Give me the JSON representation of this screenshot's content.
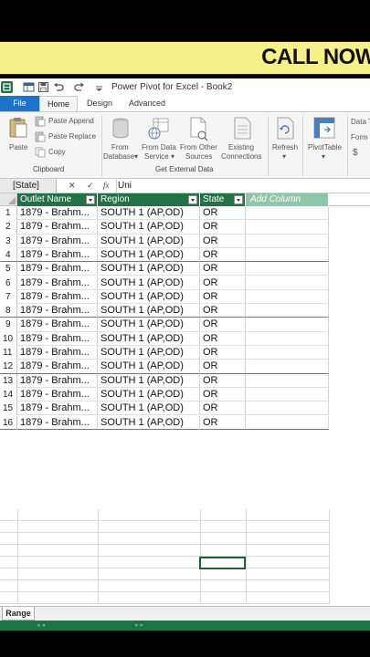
{
  "banner": {
    "text": "CALL NOW"
  },
  "window": {
    "title": "Power Pivot for Excel - Book2"
  },
  "tabs": [
    "File",
    "Home",
    "Design",
    "Advanced"
  ],
  "ribbon": {
    "paste": "Paste",
    "paste_append": "Paste Append",
    "paste_replace": "Paste Replace",
    "copy": "Copy",
    "clipboard_group": "Clipboard",
    "from_database_1": "From",
    "from_database_2": "Database",
    "from_data_service_1": "From Data",
    "from_data_service_2": "Service",
    "from_other_sources_1": "From Other",
    "from_other_sources_2": "Sources",
    "existing_connections_1": "Existing",
    "existing_connections_2": "Connections",
    "get_external_group": "Get External Data",
    "refresh": "Refresh",
    "pivottable": "PivotTable",
    "data_type": "Data T",
    "format": "Form",
    "currency": "$"
  },
  "formula_bar": {
    "name_box": "[State]",
    "cancel": "✕",
    "enter": "✓",
    "fx": "fx",
    "value": "Uni"
  },
  "table": {
    "columns": [
      "Outlet Name",
      "Region",
      "State"
    ],
    "add_column": "Add Column",
    "rows": [
      {
        "num": "1",
        "outlet": "1879 - Brahm...",
        "region": "SOUTH 1 (AP,OD)",
        "state": "OR"
      },
      {
        "num": "2",
        "outlet": "1879 - Brahm...",
        "region": "SOUTH 1 (AP,OD)",
        "state": "OR"
      },
      {
        "num": "3",
        "outlet": "1879 - Brahm...",
        "region": "SOUTH 1 (AP,OD)",
        "state": "OR"
      },
      {
        "num": "4",
        "outlet": "1879 - Brahm...",
        "region": "SOUTH 1 (AP,OD)",
        "state": "OR"
      },
      {
        "num": "5",
        "outlet": "1879 - Brahm...",
        "region": "SOUTH 1 (AP,OD)",
        "state": "OR"
      },
      {
        "num": "6",
        "outlet": "1879 - Brahm...",
        "region": "SOUTH 1 (AP,OD)",
        "state": "OR"
      },
      {
        "num": "7",
        "outlet": "1879 - Brahm...",
        "region": "SOUTH 1 (AP,OD)",
        "state": "OR"
      },
      {
        "num": "8",
        "outlet": "1879 - Brahm...",
        "region": "SOUTH 1 (AP,OD)",
        "state": "OR"
      },
      {
        "num": "9",
        "outlet": "1879 - Brahm...",
        "region": "SOUTH 1 (AP,OD)",
        "state": "OR"
      },
      {
        "num": "10",
        "outlet": "1879 - Brahm...",
        "region": "SOUTH 1 (AP,OD)",
        "state": "OR"
      },
      {
        "num": "11",
        "outlet": "1879 - Brahm...",
        "region": "SOUTH 1 (AP,OD)",
        "state": "OR"
      },
      {
        "num": "12",
        "outlet": "1879 - Brahm...",
        "region": "SOUTH 1 (AP,OD)",
        "state": "OR"
      },
      {
        "num": "13",
        "outlet": "1879 - Brahm...",
        "region": "SOUTH 1 (AP,OD)",
        "state": "OR"
      },
      {
        "num": "14",
        "outlet": "1879 - Brahm...",
        "region": "SOUTH 1 (AP,OD)",
        "state": "OR"
      },
      {
        "num": "15",
        "outlet": "1879 - Brahm...",
        "region": "SOUTH 1 (AP,OD)",
        "state": "OR"
      },
      {
        "num": "16",
        "outlet": "1879 - Brahm...",
        "region": "SOUTH 1 (AP,OD)",
        "state": "OR"
      }
    ]
  },
  "sheet": {
    "tab": "Range"
  },
  "colors": {
    "header_green": "#217346",
    "add_column_green": "#8fc7a6",
    "file_blue": "#1e73c8",
    "banner_yellow": "#f5f08a"
  }
}
